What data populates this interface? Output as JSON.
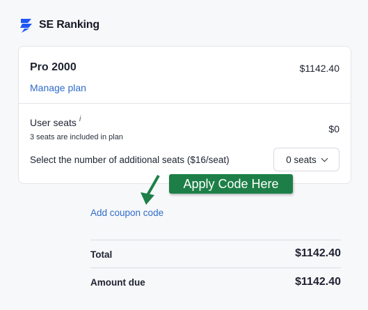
{
  "brand": {
    "name": "SE Ranking",
    "accent": "#1f57f5"
  },
  "plan": {
    "name": "Pro 2000",
    "price": "$1142.40",
    "manage_label": "Manage plan"
  },
  "seats": {
    "title": "User seats",
    "info_glyph": "i",
    "note": "3 seats are included in plan",
    "price": "$0",
    "select_label": "Select the number of additional seats ($16/seat)",
    "selected_value": "0 seats"
  },
  "annotation": {
    "label": "Apply Code Here",
    "color": "#1d7f47"
  },
  "coupon": {
    "label": "Add coupon code"
  },
  "summary": {
    "total_label": "Total",
    "total_value": "$1142.40",
    "due_label": "Amount due",
    "due_value": "$1142.40"
  },
  "colors": {
    "link": "#2f6cc9",
    "text": "#1d2230",
    "border": "#e3e5ea"
  }
}
